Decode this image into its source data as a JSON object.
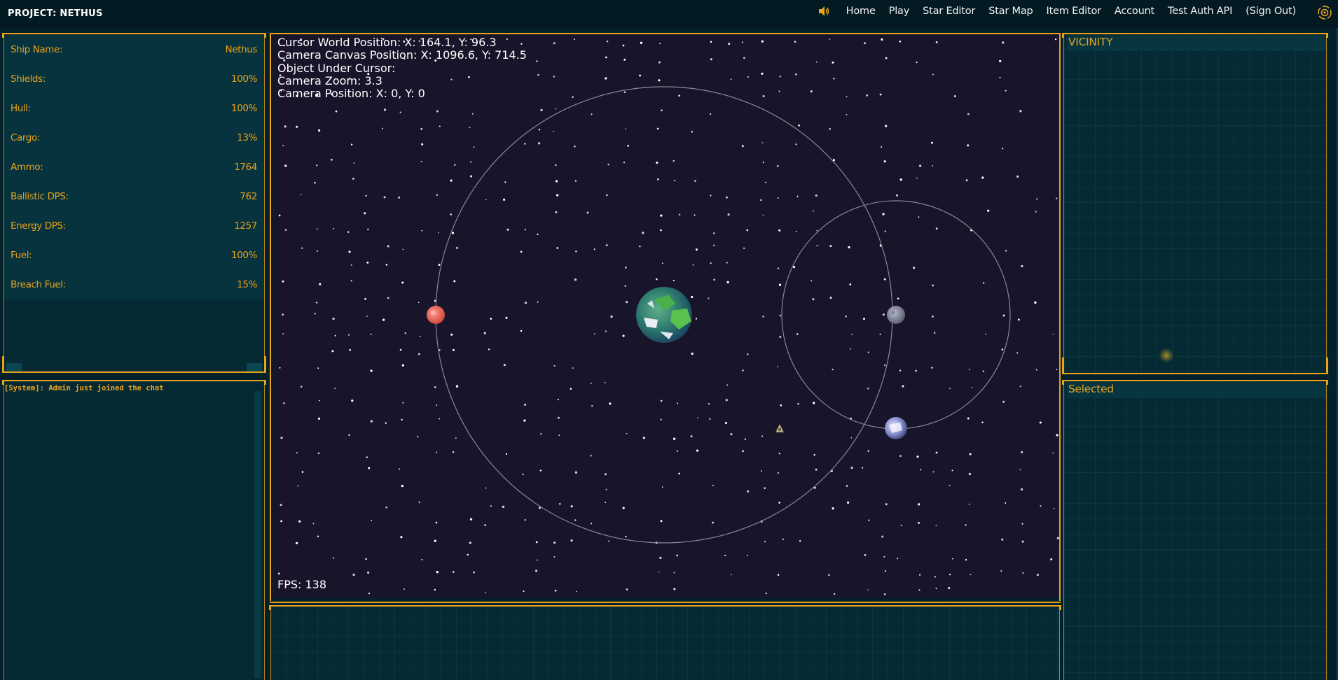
{
  "app": {
    "brand": "PROJECT: NETHUS",
    "nav": [
      "Home",
      "Play",
      "Star Editor",
      "Star Map",
      "Item Editor",
      "Account",
      "Test Auth API",
      "(Sign Out)"
    ],
    "accent_color": "#e8a21c"
  },
  "stats": [
    {
      "label": "Ship Name:",
      "value": "Nethus"
    },
    {
      "label": "Shields:",
      "value": "100%"
    },
    {
      "label": "Hull:",
      "value": "100%"
    },
    {
      "label": "Cargo:",
      "value": "13%"
    },
    {
      "label": "Ammo:",
      "value": "1764"
    },
    {
      "label": "Ballistic DPS:",
      "value": "762"
    },
    {
      "label": "Energy DPS:",
      "value": "1257"
    },
    {
      "label": "Fuel:",
      "value": "100%"
    },
    {
      "label": "Breach Fuel:",
      "value": "15%"
    }
  ],
  "chat": {
    "messages": [
      "[System]: Admin just joined the chat"
    ]
  },
  "debug": {
    "cursor_world": "Cursor World Position: X: 164.1, Y: 96.3",
    "camera_canvas": "Camera Canvas Position: X: 1096.6, Y: 714.5",
    "object_under_cursor": "Object Under Cursor:",
    "camera_zoom": "Camera Zoom: 3.3",
    "camera_position": "Camera Position: X: 0, Y: 0",
    "fps": "FPS: 138"
  },
  "vicinity": {
    "title": "VICINITY"
  },
  "selected": {
    "title": "Selected"
  }
}
